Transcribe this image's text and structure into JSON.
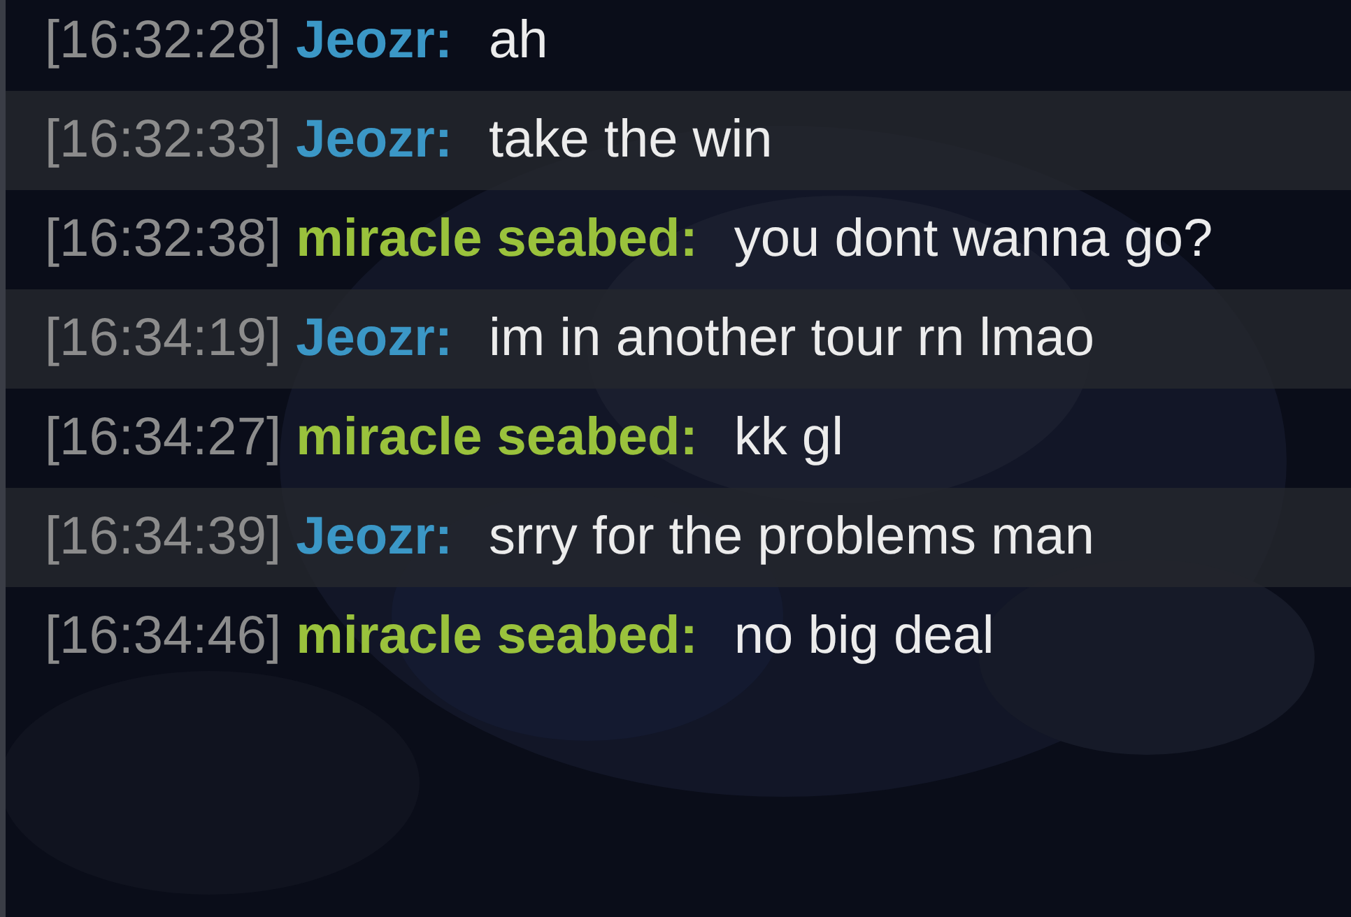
{
  "messages": [
    {
      "time": "[16:32:28]",
      "user": "Jeozr:",
      "color": "#3b97c6",
      "text": "ah"
    },
    {
      "time": "[16:32:33]",
      "user": "Jeozr:",
      "color": "#3b97c6",
      "text": "take the win"
    },
    {
      "time": "[16:32:38]",
      "user": "miracle seabed:",
      "color": "#9ac23c",
      "text": "you dont wanna go?"
    },
    {
      "time": "[16:34:19]",
      "user": "Jeozr:",
      "color": "#3b97c6",
      "text": "im in another tour rn lmao"
    },
    {
      "time": "[16:34:27]",
      "user": "miracle seabed:",
      "color": "#9ac23c",
      "text": "kk gl"
    },
    {
      "time": "[16:34:39]",
      "user": "Jeozr:",
      "color": "#3b97c6",
      "text": "srry for the problems man"
    },
    {
      "time": "[16:34:46]",
      "user": "miracle seabed:",
      "color": "#9ac23c",
      "text": "no big deal"
    }
  ]
}
